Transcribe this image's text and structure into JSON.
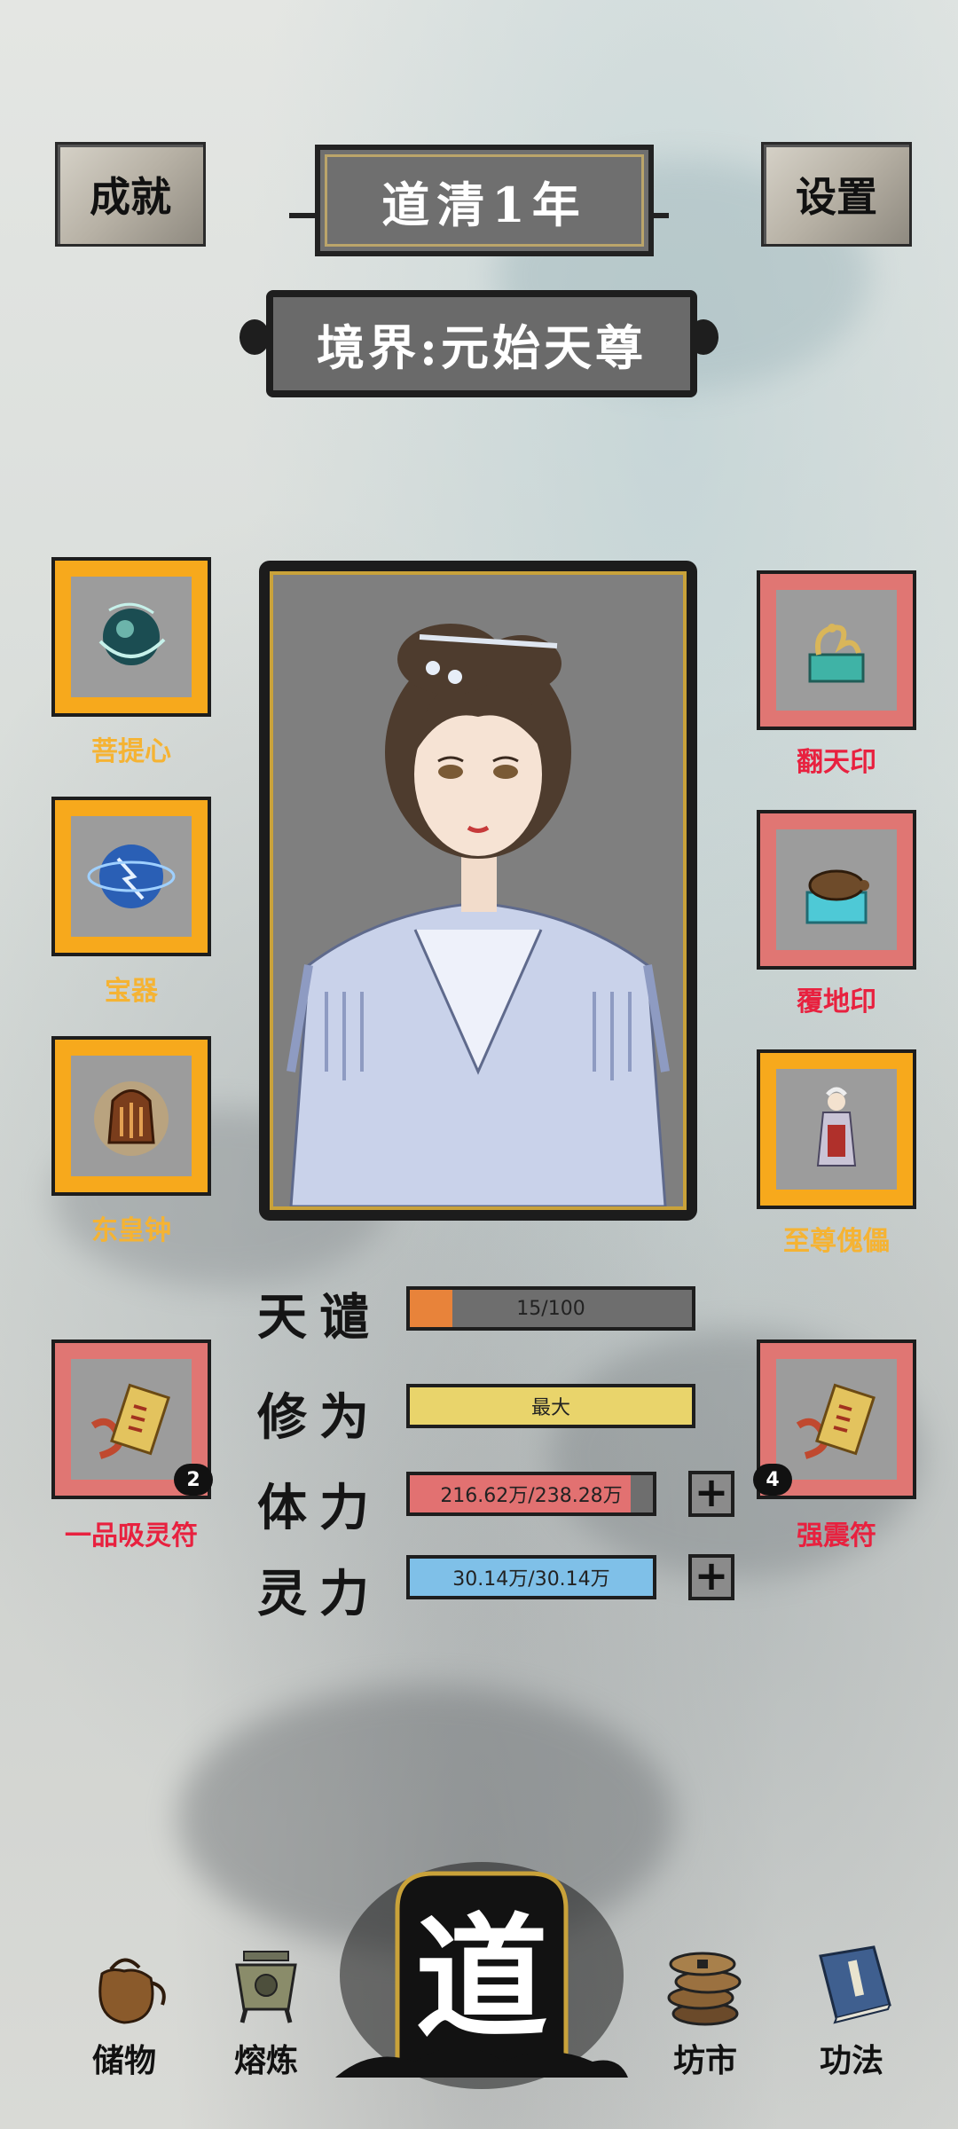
{
  "header": {
    "achievements_label": "成就",
    "year_label": "道清1年",
    "settings_label": "设置",
    "realm_label": "境界:元始天尊"
  },
  "left_slots": [
    {
      "name": "菩提心",
      "label": "菩提心",
      "border": "gold",
      "icon": "jade-orb-icon"
    },
    {
      "name": "宝器",
      "label": "宝器",
      "border": "gold",
      "icon": "lightning-orb-icon"
    },
    {
      "name": "东皇钟",
      "label": "东皇钟",
      "border": "gold",
      "icon": "bell-icon"
    },
    {
      "name": "一品吸灵符",
      "label": "一品吸灵符",
      "border": "red",
      "icon": "talisman-icon",
      "count": "2"
    }
  ],
  "right_slots": [
    {
      "name": "翻天印",
      "label": "翻天印",
      "border": "red",
      "icon": "dragon-seal-icon"
    },
    {
      "name": "覆地印",
      "label": "覆地印",
      "border": "red",
      "icon": "turtle-seal-icon"
    },
    {
      "name": "至尊傀儡",
      "label": "至尊傀儡",
      "border": "gold",
      "icon": "puppet-icon"
    },
    {
      "name": "强震符",
      "label": "强震符",
      "border": "red",
      "icon": "talisman-icon",
      "count": "4"
    }
  ],
  "stats": {
    "tianqian": {
      "label": "天谴",
      "text": "15/100",
      "fill": 0.15,
      "color": "#e8833a"
    },
    "xiuwei": {
      "label": "修为",
      "text": "最大",
      "fill": 1.0,
      "color": "#e9d46b"
    },
    "tili": {
      "label": "体力",
      "text": "216.62万/238.28万",
      "fill": 0.909,
      "color": "#e27171"
    },
    "lingli": {
      "label": "灵力",
      "text": "30.14万/30.14万",
      "fill": 1.0,
      "color": "#7fc0e8"
    }
  },
  "plus_label": "+",
  "nav": {
    "storage": "储物",
    "smelt": "熔炼",
    "dao": "道",
    "market": "坊市",
    "skills": "功法"
  },
  "colors": {
    "gold_frame": "#f7a91c",
    "red_frame": "#e07673",
    "gold_text": "#f5b333",
    "red_text": "#e8213f"
  }
}
